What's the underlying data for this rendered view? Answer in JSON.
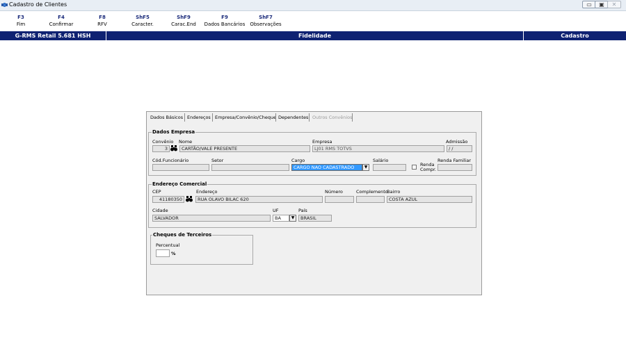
{
  "window": {
    "title": "Cadastro de Clientes",
    "controls": [
      "▭",
      "▣",
      "✕"
    ]
  },
  "function_keys": [
    {
      "key": "F3",
      "label": "Fim"
    },
    {
      "key": "F4",
      "label": "Confirmar"
    },
    {
      "key": "F8",
      "label": "RFV"
    },
    {
      "key": "ShF5",
      "label": "Caracter."
    },
    {
      "key": "ShF9",
      "label": "Carac.End"
    },
    {
      "key": "F9",
      "label": "Dados Bancários"
    },
    {
      "key": "ShF7",
      "label": "Observações"
    }
  ],
  "navbar": {
    "system": "G-RMS Retail 5.681 HSH",
    "module": "Fidelidade",
    "mode": "Cadastro",
    "color": "#0f2272"
  },
  "tabs": [
    {
      "label": "Dados Básicos",
      "disabled": false
    },
    {
      "label": "Endereços",
      "disabled": false
    },
    {
      "label": "Empresa/Convênio/Cheque",
      "disabled": false,
      "active": true
    },
    {
      "label": "Dependentes",
      "disabled": false
    },
    {
      "label": "Outros Convênios",
      "disabled": true
    }
  ],
  "dados_empresa": {
    "title": "Dados Empresa",
    "convenio_label": "Convênio",
    "convenio_value": "3",
    "nome_label": "Nome",
    "nome_value": "CARTÃO/VALE PRESENTE",
    "empresa_label": "Empresa",
    "empresa_value": "LJ01 RMS TOTVS",
    "admissao_label": "Admissão",
    "admissao_value": " / /",
    "cod_funcionario_label": "Cód.Funcionário",
    "cod_funcionario_value": "",
    "setor_label": "Setor",
    "setor_value": "",
    "cargo_label": "Cargo",
    "cargo_value": "CARGO NAO CADASTRADO",
    "salario_label": "Salário",
    "salario_value": "",
    "renda_compr_label_1": "Renda",
    "renda_compr_label_2": "Compr.",
    "renda_familiar_label": "Renda Familiar",
    "renda_familiar_value": ""
  },
  "endereco_comercial": {
    "title": "Endereço Comercial",
    "cep_label": "CEP",
    "cep_value": "41180350",
    "endereco_label": "Endereço",
    "endereco_value": "RUA OLAVO BILAC 620",
    "numero_label": "Número",
    "numero_value": "",
    "complemento_label": "Complemento",
    "complemento_value": "",
    "bairro_label": "Bairro",
    "bairro_value": "COSTA AZUL",
    "cidade_label": "Cidade",
    "cidade_value": "SALVADOR",
    "uf_label": "UF",
    "uf_value": "BA",
    "pais_label": "País",
    "pais_value": "BRASIL"
  },
  "cheques": {
    "title": "Cheques de Terceiros",
    "percentual_label": "Percentual",
    "percentual_value": "",
    "percent_sign": "%"
  },
  "icons": {
    "search": "binoculars-icon",
    "dropdown": "▼"
  }
}
